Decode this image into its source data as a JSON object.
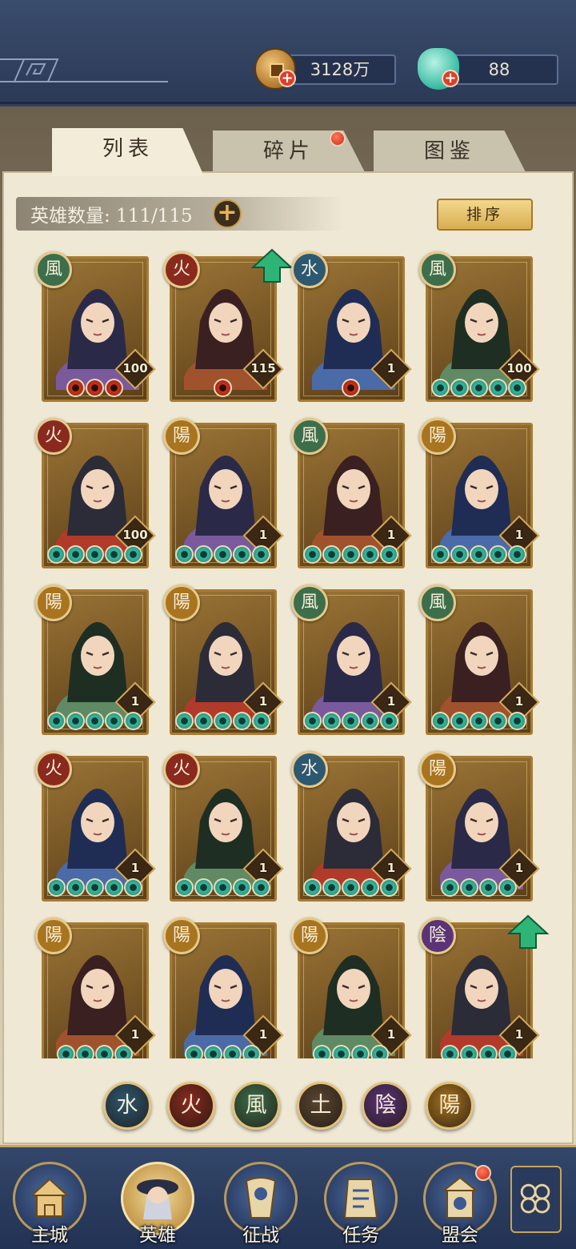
{
  "currency": {
    "coin_value": "3128万",
    "jade_value": "88"
  },
  "tabs": [
    {
      "label": "列表",
      "active": true
    },
    {
      "label": "碎片",
      "active": false,
      "has_badge": true
    },
    {
      "label": "图鉴",
      "active": false
    }
  ],
  "roster": {
    "count_label": "英雄数量: 111/115",
    "add_icon": "plus-icon",
    "sort_label": "排序"
  },
  "element_glyphs": {
    "wind": {
      "glyph": "風",
      "color": "#3d6e4c"
    },
    "fire": {
      "glyph": "火",
      "color": "#8a2a1e"
    },
    "water": {
      "glyph": "水",
      "color": "#2c5872"
    },
    "yang": {
      "glyph": "陽",
      "color": "#a8741f"
    },
    "yin": {
      "glyph": "陰",
      "color": "#5a3477"
    },
    "earth": {
      "glyph": "土",
      "color": "#5a4530"
    }
  },
  "heroes": [
    {
      "element": "wind",
      "level": "100",
      "stars": 3,
      "star_color": "red",
      "upgradable": false
    },
    {
      "element": "fire",
      "level": "115",
      "stars": 1,
      "star_color": "red",
      "upgradable": true
    },
    {
      "element": "water",
      "level": "1",
      "stars": 1,
      "star_color": "red",
      "upgradable": false
    },
    {
      "element": "wind",
      "level": "100",
      "stars": 5,
      "star_color": "green",
      "upgradable": false
    },
    {
      "element": "fire",
      "level": "100",
      "stars": 5,
      "star_color": "green",
      "upgradable": false
    },
    {
      "element": "yang",
      "level": "1",
      "stars": 5,
      "star_color": "green",
      "upgradable": false
    },
    {
      "element": "wind",
      "level": "1",
      "stars": 5,
      "star_color": "green",
      "upgradable": false
    },
    {
      "element": "yang",
      "level": "1",
      "stars": 5,
      "star_color": "green",
      "upgradable": false
    },
    {
      "element": "yang",
      "level": "1",
      "stars": 5,
      "star_color": "green",
      "upgradable": false
    },
    {
      "element": "yang",
      "level": "1",
      "stars": 5,
      "star_color": "green",
      "upgradable": false
    },
    {
      "element": "wind",
      "level": "1",
      "stars": 5,
      "star_color": "green",
      "upgradable": false
    },
    {
      "element": "wind",
      "level": "1",
      "stars": 5,
      "star_color": "green",
      "upgradable": false
    },
    {
      "element": "fire",
      "level": "1",
      "stars": 5,
      "star_color": "green",
      "upgradable": false
    },
    {
      "element": "fire",
      "level": "1",
      "stars": 5,
      "star_color": "green",
      "upgradable": false
    },
    {
      "element": "water",
      "level": "1",
      "stars": 5,
      "star_color": "green",
      "upgradable": false
    },
    {
      "element": "yang",
      "level": "1",
      "stars": 4,
      "star_color": "green",
      "upgradable": false
    },
    {
      "element": "yang",
      "level": "1",
      "stars": 4,
      "star_color": "green",
      "upgradable": false
    },
    {
      "element": "yang",
      "level": "1",
      "stars": 4,
      "star_color": "green",
      "upgradable": false
    },
    {
      "element": "yang",
      "level": "1",
      "stars": 4,
      "star_color": "green",
      "upgradable": false
    },
    {
      "element": "yin",
      "level": "1",
      "stars": 4,
      "star_color": "green",
      "upgradable": true
    }
  ],
  "filters": [
    "water",
    "fire",
    "wind",
    "earth",
    "yin",
    "yang"
  ],
  "nav": [
    {
      "label": "主城",
      "icon": "city-icon",
      "active": false
    },
    {
      "label": "英雄",
      "icon": "hero-icon",
      "active": true
    },
    {
      "label": "征战",
      "icon": "campaign-icon",
      "active": false
    },
    {
      "label": "任务",
      "icon": "task-icon",
      "active": false
    },
    {
      "label": "盟会",
      "icon": "guild-icon",
      "active": false,
      "has_badge": true
    }
  ],
  "more_icon": "menu-grid-icon"
}
